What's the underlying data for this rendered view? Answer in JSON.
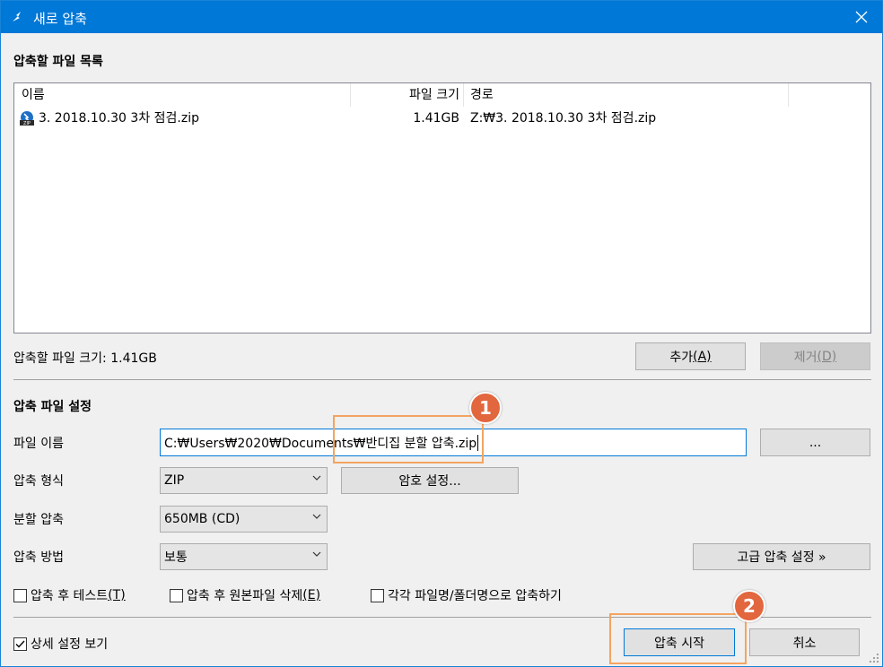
{
  "window": {
    "title": "새로 압축"
  },
  "file_list": {
    "section_title": "압축할 파일 목록",
    "columns": [
      "이름",
      "파일 크기",
      "경로"
    ],
    "rows": [
      {
        "name": "3. 2018.10.30 3차 점검.zip",
        "size": "1.41GB",
        "path": "Z:₩3. 2018.10.30 3차 점검.zip"
      }
    ],
    "total_size_label": "압축할 파일 크기: 1.41GB",
    "add_button": {
      "label": "추가",
      "mnemonic": "(A)"
    },
    "remove_button": {
      "label": "제거",
      "mnemonic": "(D)"
    }
  },
  "settings": {
    "section_title": "압축 파일 설정",
    "filename_label": "파일 이름",
    "filename_value": "C:₩Users₩2020₩Documents₩반디집 분할 압축.zip",
    "browse_button": "...",
    "format_label": "압축 형식",
    "format_value": "ZIP",
    "password_button": "암호 설정...",
    "split_label": "분할 압축",
    "split_value": "650MB (CD)",
    "method_label": "압축 방법",
    "method_value": "보통",
    "advanced_button": "고급 압축 설정 »",
    "test_after": {
      "label": "압축 후 테스트",
      "mnemonic": "(T)",
      "checked": false
    },
    "delete_after": {
      "label": "압축 후 원본파일 삭제",
      "mnemonic": "(E)",
      "checked": false
    },
    "each_file": {
      "label": "각각 파일명/폴더명으로 압축하기",
      "checked": false
    }
  },
  "footer": {
    "show_details": {
      "label": "상세 설정 보기",
      "checked": true
    },
    "start_button": "압축 시작",
    "cancel_button": "취소"
  },
  "annotations": {
    "badge1": "1",
    "badge2": "2"
  },
  "colors": {
    "titlebar": "#0078d7",
    "highlight": "#f4a460",
    "badge": "#e2663e"
  }
}
